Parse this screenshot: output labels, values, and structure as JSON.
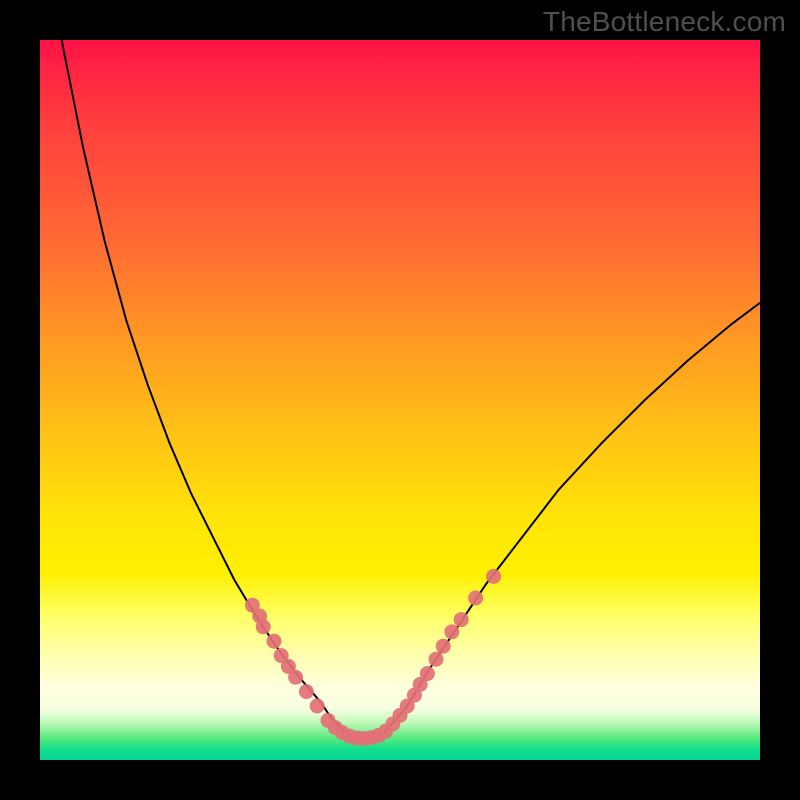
{
  "watermark": "TheBottleneck.com",
  "chart_data": {
    "type": "line",
    "title": "",
    "xlabel": "",
    "ylabel": "",
    "xlim": [
      0,
      100
    ],
    "ylim": [
      0,
      100
    ],
    "x": [
      0,
      3,
      6,
      9,
      12,
      15,
      18,
      21,
      24,
      27,
      30,
      33,
      36,
      39,
      40,
      41,
      42,
      43,
      44,
      45,
      46,
      48,
      51,
      54,
      58,
      62,
      67,
      72,
      78,
      84,
      90,
      96,
      100
    ],
    "y": [
      116,
      100,
      85,
      72,
      61,
      52,
      44,
      37,
      31,
      25,
      20,
      15.5,
      11.5,
      8,
      6.5,
      5.2,
      4.2,
      3.5,
      3.1,
      3.0,
      3.1,
      4.0,
      7.5,
      12.5,
      18.5,
      24.5,
      31,
      37.5,
      44,
      50,
      55.5,
      60.5,
      63.5
    ],
    "markers": [
      {
        "x": 29.5,
        "y": 21.5
      },
      {
        "x": 30.5,
        "y": 20.0
      },
      {
        "x": 31.0,
        "y": 18.5
      },
      {
        "x": 32.5,
        "y": 16.5
      },
      {
        "x": 33.5,
        "y": 14.5
      },
      {
        "x": 34.5,
        "y": 13.0
      },
      {
        "x": 35.5,
        "y": 11.5
      },
      {
        "x": 37.0,
        "y": 9.5
      },
      {
        "x": 38.5,
        "y": 7.5
      },
      {
        "x": 40.0,
        "y": 5.5
      },
      {
        "x": 41.0,
        "y": 4.5
      },
      {
        "x": 42.0,
        "y": 3.8
      },
      {
        "x": 43.0,
        "y": 3.3
      },
      {
        "x": 44.0,
        "y": 3.05
      },
      {
        "x": 45.0,
        "y": 3.0
      },
      {
        "x": 46.0,
        "y": 3.1
      },
      {
        "x": 47.0,
        "y": 3.4
      },
      {
        "x": 48.0,
        "y": 4.0
      },
      {
        "x": 49.0,
        "y": 5.0
      },
      {
        "x": 50.0,
        "y": 6.2
      },
      {
        "x": 51.0,
        "y": 7.5
      },
      {
        "x": 52.0,
        "y": 9.0
      },
      {
        "x": 52.8,
        "y": 10.5
      },
      {
        "x": 53.8,
        "y": 12.0
      },
      {
        "x": 55.0,
        "y": 14.0
      },
      {
        "x": 56.0,
        "y": 15.8
      },
      {
        "x": 57.2,
        "y": 17.8
      },
      {
        "x": 58.5,
        "y": 19.5
      },
      {
        "x": 60.5,
        "y": 22.5
      },
      {
        "x": 63.0,
        "y": 25.5
      }
    ],
    "marker_color": "#e37076",
    "curve_color": "#000000",
    "curve_width": 2,
    "marker_radius": 7.5
  }
}
